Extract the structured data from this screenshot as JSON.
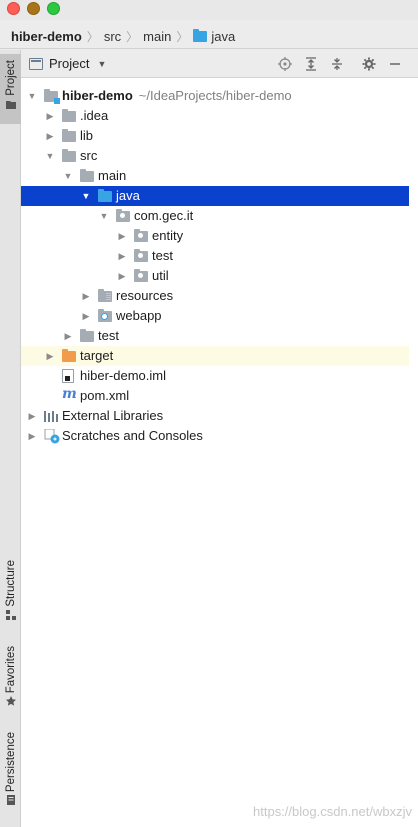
{
  "window": {
    "controls": [
      "close",
      "minimize",
      "zoom"
    ]
  },
  "breadcrumb": [
    {
      "label": "hiber-demo",
      "bold": true,
      "icon": ""
    },
    {
      "label": "src",
      "bold": false,
      "icon": ""
    },
    {
      "label": "main",
      "bold": false,
      "icon": ""
    },
    {
      "label": "java",
      "bold": false,
      "icon": "folder-blue-icon"
    }
  ],
  "tool_stripe": {
    "top": [
      {
        "label": "Project",
        "icon": "folder-icon",
        "active": true
      }
    ],
    "bottom": [
      {
        "label": "Structure",
        "icon": "structure-icon"
      },
      {
        "label": "Favorites",
        "icon": "star-icon"
      },
      {
        "label": "Persistence",
        "icon": "persistence-icon"
      }
    ]
  },
  "panel": {
    "title": "Project",
    "toolbar_icons": [
      "locate-icon",
      "expand-all-icon",
      "collapse-all-icon",
      "gear-icon",
      "hide-icon"
    ]
  },
  "tree": [
    {
      "label": "hiber-demo",
      "path": "~/IdeaProjects/hiber-demo",
      "depth": 0,
      "expanded": true,
      "icon": "module-icon",
      "bold": true
    },
    {
      "label": ".idea",
      "depth": 1,
      "expanded": false,
      "icon": "folder-gray-icon"
    },
    {
      "label": "lib",
      "depth": 1,
      "expanded": false,
      "icon": "folder-gray-icon"
    },
    {
      "label": "src",
      "depth": 1,
      "expanded": true,
      "icon": "folder-gray-icon"
    },
    {
      "label": "main",
      "depth": 2,
      "expanded": true,
      "icon": "folder-gray-icon"
    },
    {
      "label": "java",
      "depth": 3,
      "expanded": true,
      "icon": "folder-blue-icon",
      "selected": true
    },
    {
      "label": "com.gec.it",
      "depth": 4,
      "expanded": true,
      "icon": "package-icon"
    },
    {
      "label": "entity",
      "depth": 5,
      "expanded": false,
      "icon": "package-icon"
    },
    {
      "label": "test",
      "depth": 5,
      "expanded": false,
      "icon": "package-icon"
    },
    {
      "label": "util",
      "depth": 5,
      "expanded": false,
      "icon": "package-icon"
    },
    {
      "label": "resources",
      "depth": 3,
      "expanded": false,
      "icon": "resources-folder-icon"
    },
    {
      "label": "webapp",
      "depth": 3,
      "expanded": false,
      "icon": "web-folder-icon"
    },
    {
      "label": "test",
      "depth": 2,
      "expanded": false,
      "icon": "folder-gray-icon"
    },
    {
      "label": "target",
      "depth": 1,
      "expanded": false,
      "icon": "folder-orange-icon",
      "highlight": true
    },
    {
      "label": "hiber-demo.iml",
      "depth": 1,
      "leaf": true,
      "icon": "iml-file-icon"
    },
    {
      "label": "pom.xml",
      "depth": 1,
      "leaf": true,
      "icon": "maven-icon"
    },
    {
      "label": "External Libraries",
      "depth": 0,
      "expanded": false,
      "icon": "libraries-icon"
    },
    {
      "label": "Scratches and Consoles",
      "depth": 0,
      "expanded": false,
      "icon": "scratches-icon"
    }
  ],
  "colors": {
    "selection": "#0b42cd",
    "highlight_row": "#fdfbe4",
    "source_folder": "#39a4e4",
    "excluded_folder": "#f29c4b"
  },
  "watermark": "https://blog.csdn.net/wbxzjv"
}
